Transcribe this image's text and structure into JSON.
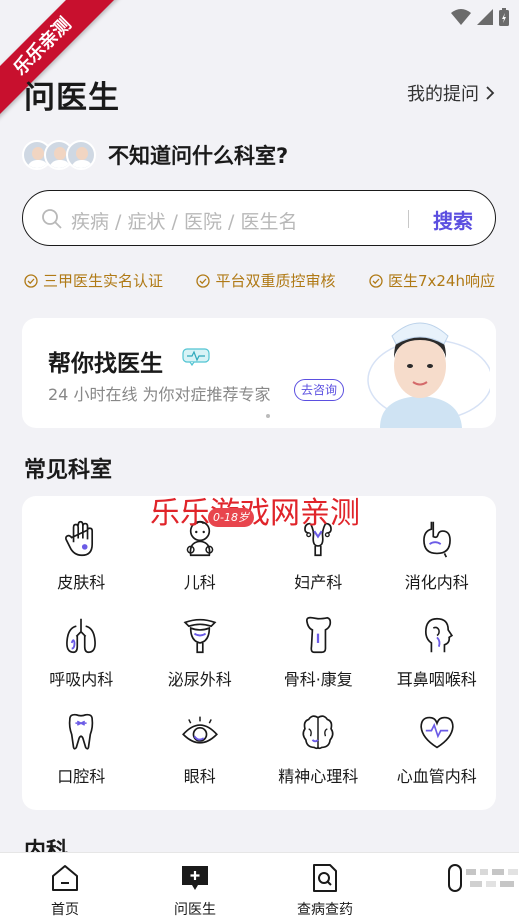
{
  "watermark_ribbon": "乐乐亲测",
  "header": {
    "title": "问医生",
    "my_questions": "我的提问"
  },
  "dept_question": "不知道问什么科室?",
  "search": {
    "placeholder": "疾病 / 症状 / 医院 / 医生名",
    "button": "搜索"
  },
  "badges": [
    "三甲医生实名认证",
    "平台双重质控审核",
    "医生7x24h响应"
  ],
  "promo": {
    "title": "帮你找医生",
    "subtitle": "24 小时在线 为你对症推荐专家",
    "consult": "去咨询"
  },
  "sections": {
    "common": "常见科室",
    "internal": "内科"
  },
  "departments": [
    {
      "label": "皮肤科",
      "icon": "hand-icon"
    },
    {
      "label": "儿科",
      "icon": "baby-icon"
    },
    {
      "label": "妇产科",
      "icon": "uterus-icon"
    },
    {
      "label": "消化内科",
      "icon": "stomach-icon"
    },
    {
      "label": "呼吸内科",
      "icon": "lungs-icon"
    },
    {
      "label": "泌尿外科",
      "icon": "bladder-icon"
    },
    {
      "label": "骨科·康复",
      "icon": "bone-icon"
    },
    {
      "label": "耳鼻咽喉科",
      "icon": "head-throat-icon"
    },
    {
      "label": "口腔科",
      "icon": "tooth-icon"
    },
    {
      "label": "眼科",
      "icon": "eye-icon"
    },
    {
      "label": "精神心理科",
      "icon": "brain-icon"
    },
    {
      "label": "心血管内科",
      "icon": "heart-icon"
    }
  ],
  "overlay": {
    "watermark_text": "乐乐游戏网亲测",
    "age_badge": "0-18岁"
  },
  "tabs": [
    {
      "label": "首页",
      "icon": "home-icon"
    },
    {
      "label": "问医生",
      "icon": "chat-plus-icon"
    },
    {
      "label": "查病查药",
      "icon": "document-search-icon"
    }
  ],
  "colors": {
    "accent": "#5b4fe0",
    "badge": "#b07a16",
    "watermark": "#e0242a",
    "ribbon": "#c8102e"
  }
}
